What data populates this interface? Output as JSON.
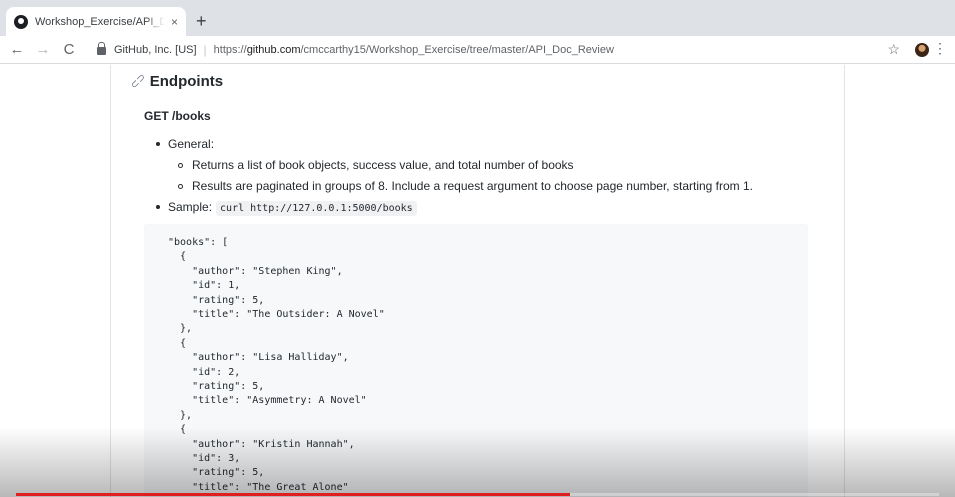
{
  "browser": {
    "tab_title": "Workshop_Exercise/API_Doc_R",
    "tab_close": "×",
    "new_tab": "+",
    "back": "←",
    "forward": "→",
    "reload": "C",
    "site_identity": "GitHub, Inc. [US]",
    "separator": "|",
    "url_prefix": "https://",
    "url_host": "github.com",
    "url_path": "/cmccarthy15/Workshop_Exercise/tree/master/API_Doc_Review",
    "star": "☆",
    "menu": "⋮",
    "icons": [
      "github-favicon-icon",
      "lock-icon",
      "star-icon",
      "profile-avatar",
      "kebab-menu-icon"
    ]
  },
  "doc": {
    "heading": "Endpoints",
    "subheading": "GET /books",
    "list": {
      "general": "General:",
      "sub1": "Returns a list of book objects, success value, and total number of books",
      "sub2": "Results are paginated in groups of 8. Include a request argument to choose page number, starting from 1.",
      "sample": "Sample:",
      "sample_code": "curl http://127.0.0.1:5000/books"
    },
    "code_lines": [
      "\"books\": [",
      "  {",
      "    \"author\": \"Stephen King\",",
      "    \"id\": 1,",
      "    \"rating\": 5,",
      "    \"title\": \"The Outsider: A Novel\"",
      "  },",
      "  {",
      "    \"author\": \"Lisa Halliday\",",
      "    \"id\": 2,",
      "    \"rating\": 5,",
      "    \"title\": \"Asymmetry: A Novel\"",
      "  },",
      "  {",
      "    \"author\": \"Kristin Hannah\",",
      "    \"id\": 3,",
      "    \"rating\": 5,",
      "    \"title\": \"The Great Alone\""
    ]
  },
  "video": {
    "progress_fraction": 0.6
  },
  "colors": {
    "tab_strip": "#dee1e6",
    "code_background": "#f6f8fa",
    "progress": "#e02020",
    "text": "#24292e"
  }
}
